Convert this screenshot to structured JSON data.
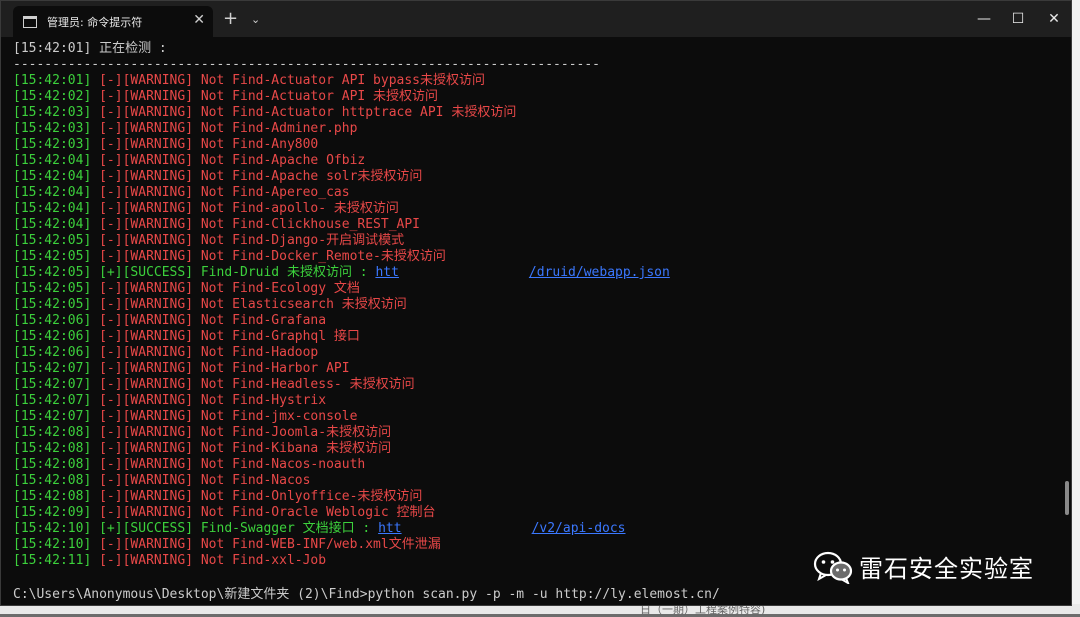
{
  "window": {
    "tab_title": "管理员: 命令提示符",
    "new_tab": "+",
    "dropdown": "⌄",
    "tab_close": "✕",
    "minimize": "—",
    "maximize": "☐",
    "close": "✕"
  },
  "header": {
    "detect_line": "[15:42:01] 正在检测 : ",
    "divider": "---------------------------------------------------------------------------"
  },
  "log": [
    {
      "time": "[15:42:01]",
      "tag": "[-][WARNING]",
      "msg": "Not Find-Actuator API bypass未授权访问",
      "type": "warning"
    },
    {
      "time": "[15:42:02]",
      "tag": "[-][WARNING]",
      "msg": "Not Find-Actuator API 未授权访问",
      "type": "warning"
    },
    {
      "time": "[15:42:03]",
      "tag": "[-][WARNING]",
      "msg": "Not Find-Actuator httptrace API 未授权访问",
      "type": "warning"
    },
    {
      "time": "[15:42:03]",
      "tag": "[-][WARNING]",
      "msg": "Not Find-Adminer.php",
      "type": "warning"
    },
    {
      "time": "[15:42:03]",
      "tag": "[-][WARNING]",
      "msg": "Not Find-Any800",
      "type": "warning"
    },
    {
      "time": "[15:42:04]",
      "tag": "[-][WARNING]",
      "msg": "Not Find-Apache Ofbiz",
      "type": "warning"
    },
    {
      "time": "[15:42:04]",
      "tag": "[-][WARNING]",
      "msg": "Not Find-Apache solr未授权访问",
      "type": "warning"
    },
    {
      "time": "[15:42:04]",
      "tag": "[-][WARNING]",
      "msg": "Not Find-Apereo_cas",
      "type": "warning"
    },
    {
      "time": "[15:42:04]",
      "tag": "[-][WARNING]",
      "msg": "Not Find-apollo- 未授权访问",
      "type": "warning"
    },
    {
      "time": "[15:42:04]",
      "tag": "[-][WARNING]",
      "msg": "Not Find-Clickhouse_REST_API",
      "type": "warning"
    },
    {
      "time": "[15:42:05]",
      "tag": "[-][WARNING]",
      "msg": "Not Find-Django-开启调试模式",
      "type": "warning"
    },
    {
      "time": "[15:42:05]",
      "tag": "[-][WARNING]",
      "msg": "Not Find-Docker_Remote-未授权访问",
      "type": "warning"
    },
    {
      "time": "[15:42:05]",
      "tag": "[+][SUCCESS]",
      "msg": "Find-Druid 未授权访问 : ",
      "link_start": "htt",
      "link_end": "/druid/webapp.json",
      "type": "success"
    },
    {
      "time": "[15:42:05]",
      "tag": "[-][WARNING]",
      "msg": "Not Find-Ecology 文档",
      "type": "warning"
    },
    {
      "time": "[15:42:05]",
      "tag": "[-][WARNING]",
      "msg": "Not Elasticsearch 未授权访问",
      "type": "warning"
    },
    {
      "time": "[15:42:06]",
      "tag": "[-][WARNING]",
      "msg": "Not Find-Grafana",
      "type": "warning"
    },
    {
      "time": "[15:42:06]",
      "tag": "[-][WARNING]",
      "msg": "Not Find-Graphql 接口",
      "type": "warning"
    },
    {
      "time": "[15:42:06]",
      "tag": "[-][WARNING]",
      "msg": "Not Find-Hadoop",
      "type": "warning"
    },
    {
      "time": "[15:42:07]",
      "tag": "[-][WARNING]",
      "msg": "Not Find-Harbor API",
      "type": "warning"
    },
    {
      "time": "[15:42:07]",
      "tag": "[-][WARNING]",
      "msg": "Not Find-Headless- 未授权访问",
      "type": "warning"
    },
    {
      "time": "[15:42:07]",
      "tag": "[-][WARNING]",
      "msg": "Not Find-Hystrix",
      "type": "warning"
    },
    {
      "time": "[15:42:07]",
      "tag": "[-][WARNING]",
      "msg": "Not Find-jmx-console",
      "type": "warning"
    },
    {
      "time": "[15:42:08]",
      "tag": "[-][WARNING]",
      "msg": "Not Find-Joomla-未授权访问",
      "type": "warning"
    },
    {
      "time": "[15:42:08]",
      "tag": "[-][WARNING]",
      "msg": "Not Find-Kibana 未授权访问",
      "type": "warning"
    },
    {
      "time": "[15:42:08]",
      "tag": "[-][WARNING]",
      "msg": "Not Find-Nacos-noauth",
      "type": "warning"
    },
    {
      "time": "[15:42:08]",
      "tag": "[-][WARNING]",
      "msg": "Not Find-Nacos",
      "type": "warning"
    },
    {
      "time": "[15:42:08]",
      "tag": "[-][WARNING]",
      "msg": "Not Find-Onlyoffice-未授权访问",
      "type": "warning"
    },
    {
      "time": "[15:42:09]",
      "tag": "[-][WARNING]",
      "msg": "Not Find-Oracle Weblogic 控制台",
      "type": "warning"
    },
    {
      "time": "[15:42:10]",
      "tag": "[+][SUCCESS]",
      "msg": "Find-Swagger 文档接口 : ",
      "link_start": "htt",
      "link_end": "/v2/api-docs",
      "type": "success"
    },
    {
      "time": "[15:42:10]",
      "tag": "[-][WARNING]",
      "msg": "Not Find-WEB-INF/web.xml文件泄漏",
      "type": "warning"
    },
    {
      "time": "[15:42:11]",
      "tag": "[-][WARNING]",
      "msg": "Not Find-xxl-Job",
      "type": "warning"
    }
  ],
  "command": "C:\\Users\\Anonymous\\Desktop\\新建文件夹 (2)\\Find>python scan.py -p -m -u http://ly.elemost.cn/",
  "watermark": {
    "text": "雷石安全实验室"
  },
  "background": {
    "bottom_text": "日（一期）工程案例特容)"
  },
  "colors": {
    "warning": "#e84848",
    "success": "#3cd13c",
    "time": "#3cd13c",
    "link": "#3b78ff",
    "console_bg": "#0c0c0c"
  }
}
